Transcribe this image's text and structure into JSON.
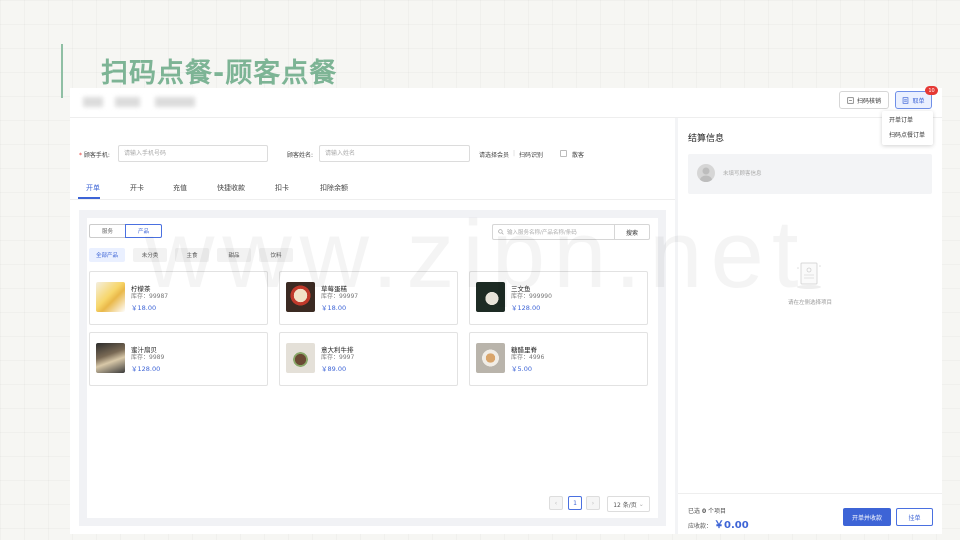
{
  "slide": {
    "title": "扫码点餐-顾客点餐"
  },
  "header": {
    "scan_verify_label": "扫码核销",
    "takeout_label": "取单",
    "takeout_badge": "10",
    "dropdown": [
      "开单订单",
      "扫码点餐订单"
    ]
  },
  "form": {
    "phone_label": "顾客手机:",
    "phone_placeholder": "请输入手机号码",
    "name_label": "顾客姓名:",
    "name_placeholder": "请输入姓名",
    "member_label": "请选择会员",
    "scan_label": "扫码识别",
    "anon_label": "散客"
  },
  "tabs": [
    "开单",
    "开卡",
    "充值",
    "快捷收款",
    "扣卡",
    "扣除余额"
  ],
  "catalog": {
    "toggle": [
      "服务",
      "产品"
    ],
    "search_placeholder": "输入服务名称/产品名称/条码",
    "search_button": "搜索",
    "categories": [
      "全部产品",
      "未分类",
      "主食",
      "甜品",
      "饮料"
    ]
  },
  "products": [
    {
      "name": "柠檬茶",
      "stock": "库存：99987",
      "price": "￥18.00"
    },
    {
      "name": "草莓蛋糕",
      "stock": "库存：99997",
      "price": "￥18.00"
    },
    {
      "name": "三文鱼",
      "stock": "库存：999990",
      "price": "￥128.00"
    },
    {
      "name": "蜜汁扇贝",
      "stock": "库存：9989",
      "price": "￥128.00"
    },
    {
      "name": "意大利牛排",
      "stock": "库存：9997",
      "price": "￥89.00"
    },
    {
      "name": "糖醋里脊",
      "stock": "库存：4996",
      "price": "￥5.00"
    }
  ],
  "pagination": {
    "current": "1",
    "page_size": "12 条/页"
  },
  "checkout": {
    "title": "结算信息",
    "customer_placeholder": "未填写顾客信息",
    "empty_text": "请在左侧选择项目",
    "selected_prefix": "已选",
    "selected_count": "0",
    "selected_suffix": "个项目",
    "due_label": "应收款：",
    "due_amount": "￥0.00",
    "checkout_button": "开单并收款",
    "hold_button": "挂单"
  },
  "watermark": "www.zipn.net"
}
